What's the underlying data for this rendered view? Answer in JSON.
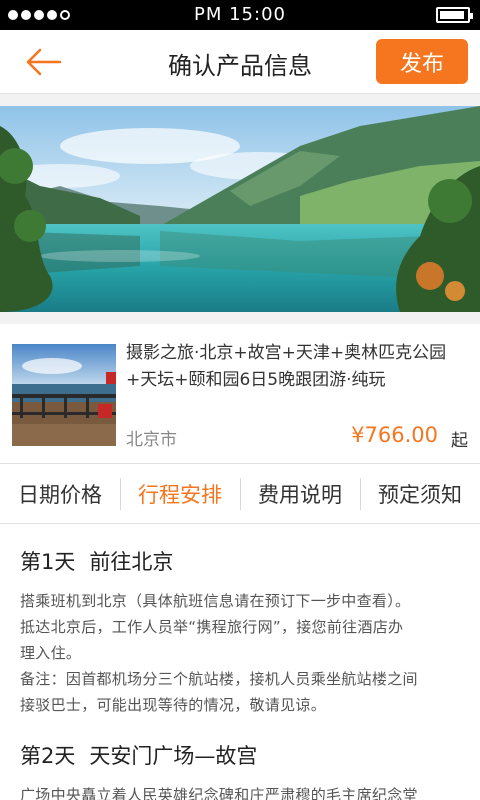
{
  "status_bar": {
    "time": "PM 15:00",
    "signal_bars": 4,
    "signal_max": 5
  },
  "nav": {
    "back_icon": "arrow-left-icon",
    "title": "确认产品信息",
    "publish_label": "发布"
  },
  "product": {
    "title": "摄影之旅·北京+故宫+天津+奥林匹克公园+天坛+颐和园6日5晚跟团游·纯玩",
    "location": "北京市",
    "price": "¥766.00",
    "price_suffix": "起"
  },
  "tabs": [
    {
      "label": "日期价格",
      "active": false
    },
    {
      "label": "行程安排",
      "active": true
    },
    {
      "label": "费用说明",
      "active": false
    },
    {
      "label": "预定须知",
      "active": false
    }
  ],
  "itinerary": [
    {
      "day": "第1天",
      "title": "前往北京",
      "lines": [
        "搭乘班机到北京（具体航班信息请在预订下一步中查看）。",
        "抵达北京后，工作人员举“携程旅行网”，接您前往酒店办",
        "理入住。",
        "备注：因首都机场分三个航站楼，接机人员乘坐航站楼之间",
        "接驳巴士，可能出现等待的情况，敬请见谅。"
      ]
    },
    {
      "day": "第2天",
      "title": "天安门广场—故宫",
      "lines": [
        "广场中央矗立着人民英雄纪念碑和庄严肃穆的毛主席纪念堂"
      ]
    }
  ],
  "colors": {
    "accent": "#f5761f",
    "status_bar": "#000000",
    "divider": "#e2e2e2"
  }
}
